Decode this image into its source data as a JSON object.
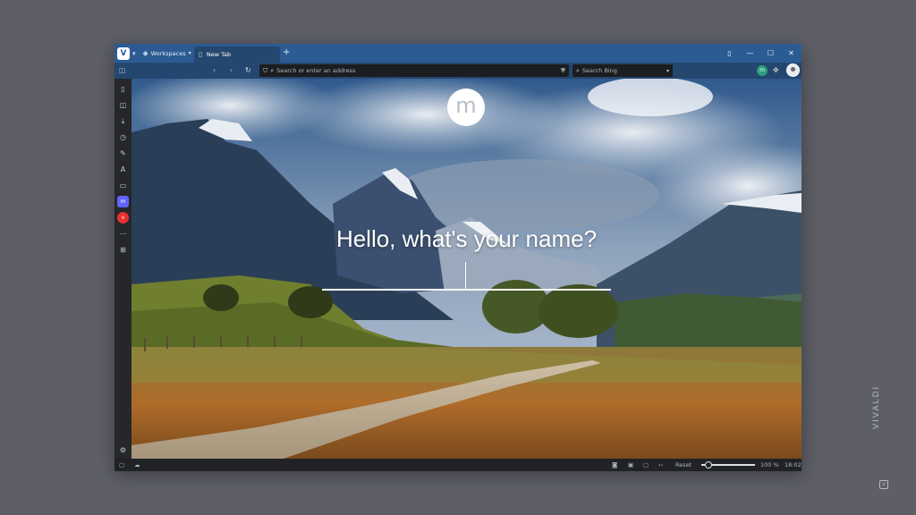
{
  "tabbar": {
    "workspaces_label": "Workspaces",
    "tab_title": "New Tab",
    "new_tab_glyph": "+",
    "window_controls": [
      "▯",
      "—",
      "☐",
      "✕"
    ]
  },
  "addressbar": {
    "url_placeholder": "Search or enter an address",
    "search_placeholder": "Search Bing",
    "extension_badge": "m"
  },
  "sidebar": {
    "icons": [
      "bookmarks-icon",
      "reading-list-icon",
      "downloads-icon",
      "history-icon",
      "notes-icon",
      "translate-icon",
      "window-icon",
      "mastodon-icon",
      "vivaldi-icon",
      "more-icon",
      "add-panel-icon",
      "settings-icon"
    ]
  },
  "content": {
    "logo_letter": "m",
    "greeting": "Hello, what's your name?",
    "name_value": ""
  },
  "statusbar": {
    "reset_label": "Reset",
    "zoom_level": "100 %",
    "clock": "18:02"
  },
  "watermark": "VIVALDI",
  "colors": {
    "tabbar": "#2c5b94",
    "addressbar": "#24476f",
    "panel": "#25272b",
    "desktop": "#5d5e66"
  }
}
